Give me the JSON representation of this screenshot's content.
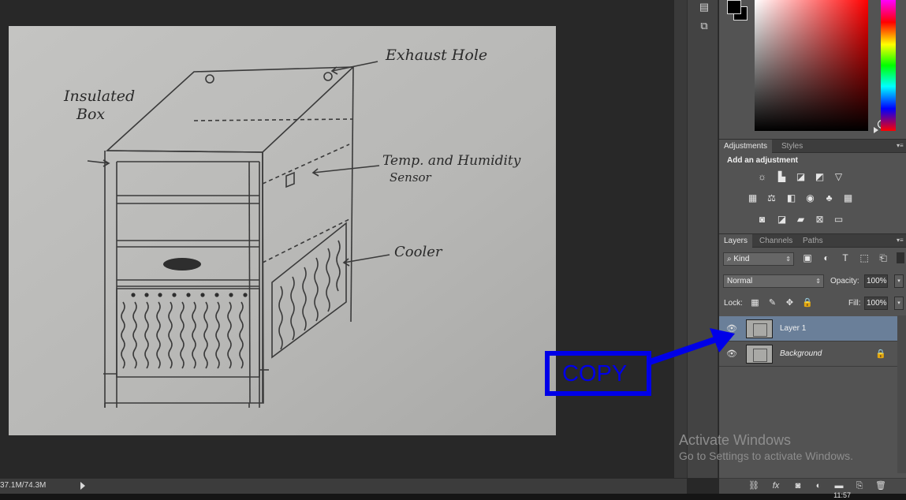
{
  "document": {
    "annotations": {
      "exhaust_hole": "Exhaust Hole",
      "insulated": "Insulated",
      "box": "Box",
      "sensor_line1": "Temp. and Humidity",
      "sensor_line2": "Sensor",
      "cooler": "Cooler"
    }
  },
  "status_bar": {
    "doc_size": "37.1M/74.3M"
  },
  "taskbar": {
    "time": "11:57"
  },
  "panels": {
    "adjustments": {
      "tabs": [
        "Adjustments",
        "Styles"
      ],
      "heading": "Add an adjustment",
      "icons_row1": [
        "brightness-contrast-icon",
        "levels-icon",
        "curves-icon",
        "exposure-icon",
        "vibrance-icon"
      ],
      "icons_row2": [
        "hue-saturation-icon",
        "color-balance-icon",
        "black-white-icon",
        "photo-filter-icon",
        "channel-mixer-icon",
        "color-lookup-icon"
      ],
      "icons_row3": [
        "invert-icon",
        "posterize-icon",
        "threshold-icon",
        "selective-color-icon",
        "gradient-map-icon"
      ]
    },
    "layers": {
      "tabs": [
        "Layers",
        "Channels",
        "Paths"
      ],
      "filter_kind": "Kind",
      "blend_mode": "Normal",
      "opacity_label": "Opacity:",
      "opacity_value": "100%",
      "lock_label": "Lock:",
      "fill_label": "Fill:",
      "fill_value": "100%",
      "items": [
        {
          "name": "Layer 1",
          "selected": true,
          "locked": false
        },
        {
          "name": "Background",
          "selected": false,
          "locked": true
        }
      ]
    }
  },
  "overlay": {
    "copy_label": "COPY",
    "copy_color": "#0000e8"
  },
  "watermark": {
    "title": "Activate Windows",
    "subtitle": "Go to Settings to activate Windows."
  },
  "colors": {
    "selected_layer": "#6a7f99",
    "panel_bg": "#535353",
    "canvas_bg": "#282828"
  }
}
